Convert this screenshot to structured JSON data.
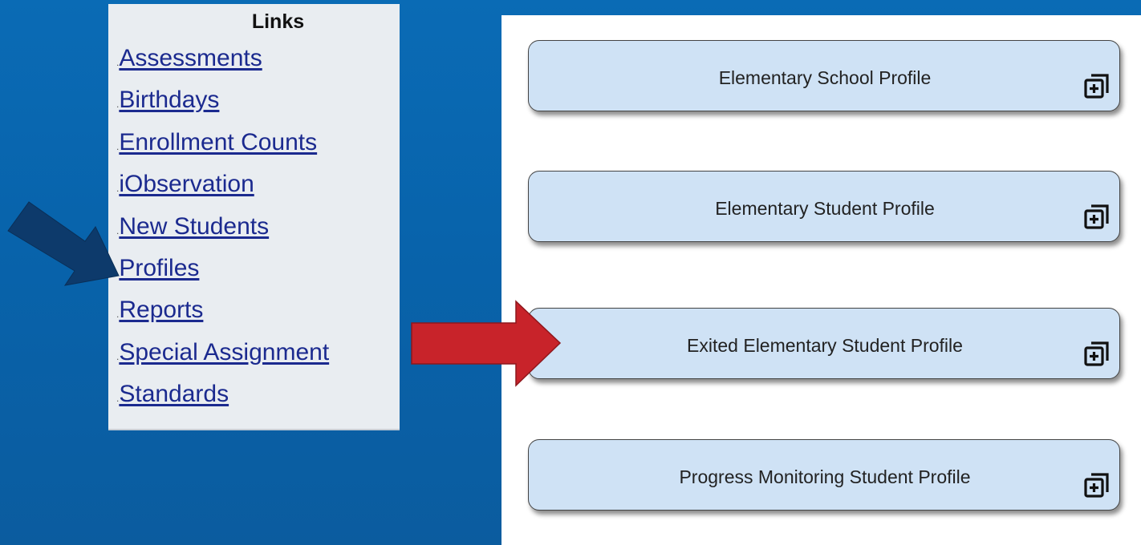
{
  "links": {
    "title": "Links",
    "items": [
      {
        "bullet": ".",
        "label": "Assessments"
      },
      {
        "bullet": ".",
        "label": "Birthdays"
      },
      {
        "bullet": ".",
        "label": "Enrollment Counts"
      },
      {
        "bullet": ".",
        "label": "iObservation"
      },
      {
        "bullet": ".",
        "label": "New Students"
      },
      {
        "bullet": ".",
        "label": "Profiles"
      },
      {
        "bullet": ".",
        "label": "Reports"
      },
      {
        "bullet": ".",
        "label": "Special Assignment"
      },
      {
        "bullet": ".",
        "label": "Standards"
      }
    ]
  },
  "profiles": [
    {
      "label": "Elementary School Profile",
      "icon": "expand-icon"
    },
    {
      "label": "Elementary Student Profile",
      "icon": "expand-icon"
    },
    {
      "label": "Exited Elementary Student Profile",
      "icon": "expand-icon"
    },
    {
      "label": "Progress Monitoring Student Profile",
      "icon": "expand-icon"
    }
  ],
  "colors": {
    "background": "#0863ab",
    "panel": "#e9edf1",
    "link": "#1b2a8f",
    "card": "#cfe2f5",
    "navy_arrow": "#0d3a6b",
    "red_arrow": "#c8232a"
  }
}
